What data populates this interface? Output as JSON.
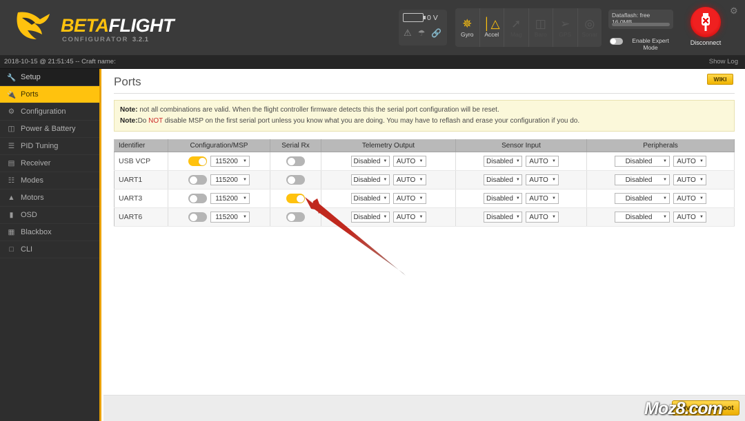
{
  "app": {
    "brand_beta": "BETA",
    "brand_flight": "FLIGHT",
    "subtitle": "CONFIGURATOR",
    "version": "3.2.1",
    "accent_color": "#ffc20e",
    "header_bg": "#3a3a3a"
  },
  "header": {
    "battery": {
      "voltage": "0 V",
      "warning_icon": "warning-triangle-icon",
      "chute_icon": "parachute-icon",
      "link_icon": "link-icon"
    },
    "sensors": [
      {
        "label": "Gyro",
        "glyph": "✵",
        "active": true
      },
      {
        "label": "Accel",
        "glyph": "⑂",
        "active": true
      },
      {
        "label": "Mag",
        "glyph": "↑",
        "active": false
      },
      {
        "label": "Baro",
        "glyph": "ἲ1",
        "active": false
      },
      {
        "label": "GPS",
        "glyph": "➿",
        "active": false
      },
      {
        "label": "Sonar",
        "glyph": "◎",
        "active": false
      }
    ],
    "dataflash": {
      "label": "Dataflash: free",
      "value": "16.0MB"
    },
    "expert_mode": {
      "label": "Enable Expert Mode",
      "enabled": false
    },
    "disconnect": {
      "label": "Disconnect",
      "color": "#e60000"
    },
    "settings_icon": "gear-icon"
  },
  "statusbar": {
    "left": "2018-10-15 @ 21:51:45 -- Craft name:",
    "right": "Show Log"
  },
  "sidebar": {
    "items": [
      {
        "label": "Setup",
        "icon": "wrench-icon",
        "active": false,
        "first": true
      },
      {
        "label": "Ports",
        "icon": "plug-icon",
        "active": true,
        "first": false
      },
      {
        "label": "Configuration",
        "icon": "gear-icon",
        "active": false,
        "first": false
      },
      {
        "label": "Power & Battery",
        "icon": "battery-icon",
        "active": false,
        "first": false
      },
      {
        "label": "PID Tuning",
        "icon": "sliders-icon",
        "active": false,
        "first": false
      },
      {
        "label": "Receiver",
        "icon": "remote-icon",
        "active": false,
        "first": false
      },
      {
        "label": "Modes",
        "icon": "switches-icon",
        "active": false,
        "first": false
      },
      {
        "label": "Motors",
        "icon": "motor-icon",
        "active": false,
        "first": false
      },
      {
        "label": "OSD",
        "icon": "screen-icon",
        "active": false,
        "first": false
      },
      {
        "label": "Blackbox",
        "icon": "chip-icon",
        "active": false,
        "first": false
      },
      {
        "label": "CLI",
        "icon": "terminal-icon",
        "active": false,
        "first": false
      }
    ]
  },
  "page": {
    "title": "Ports",
    "wiki_label": "WIKI",
    "notes": [
      {
        "prefix": "Note",
        "text": "not all combinations are valid. When the flight controller firmware detects this the serial port configuration will be reset."
      },
      {
        "prefix": "Note",
        "pre": "Do ",
        "red": "NOT",
        "post": " disable MSP on the first serial port unless you know what you are doing. You may have to reflash and erase your configuration if you do."
      }
    ]
  },
  "table": {
    "columns": [
      "Identifier",
      "Configuration/MSP",
      "Serial Rx",
      "Telemetry Output",
      "Sensor Input",
      "Peripherals"
    ],
    "rows": [
      {
        "identifier": "USB VCP",
        "msp_enabled": true,
        "baud": "115200",
        "serial_rx": false,
        "telemetry": {
          "function": "Disabled",
          "baud": "AUTO"
        },
        "sensor": {
          "function": "Disabled",
          "baud": "AUTO"
        },
        "peripheral": {
          "function": "Disabled",
          "baud": "AUTO"
        }
      },
      {
        "identifier": "UART1",
        "msp_enabled": false,
        "baud": "115200",
        "serial_rx": false,
        "telemetry": {
          "function": "Disabled",
          "baud": "AUTO"
        },
        "sensor": {
          "function": "Disabled",
          "baud": "AUTO"
        },
        "peripheral": {
          "function": "Disabled",
          "baud": "AUTO"
        }
      },
      {
        "identifier": "UART3",
        "msp_enabled": false,
        "baud": "115200",
        "serial_rx": true,
        "telemetry": {
          "function": "Disabled",
          "baud": "AUTO"
        },
        "sensor": {
          "function": "Disabled",
          "baud": "AUTO"
        },
        "peripheral": {
          "function": "Disabled",
          "baud": "AUTO"
        }
      },
      {
        "identifier": "UART6",
        "msp_enabled": false,
        "baud": "115200",
        "serial_rx": false,
        "telemetry": {
          "function": "Disabled",
          "baud": "AUTO"
        },
        "sensor": {
          "function": "Disabled",
          "baud": "AUTO"
        },
        "peripheral": {
          "function": "Disabled",
          "baud": "AUTO"
        }
      }
    ]
  },
  "footer": {
    "save_label": "Save and Reboot"
  },
  "annotation": {
    "arrow_color": "#c0281e",
    "points_to": "uart3-serial-rx-toggle"
  },
  "watermark": {
    "text": "Moz8.com"
  }
}
